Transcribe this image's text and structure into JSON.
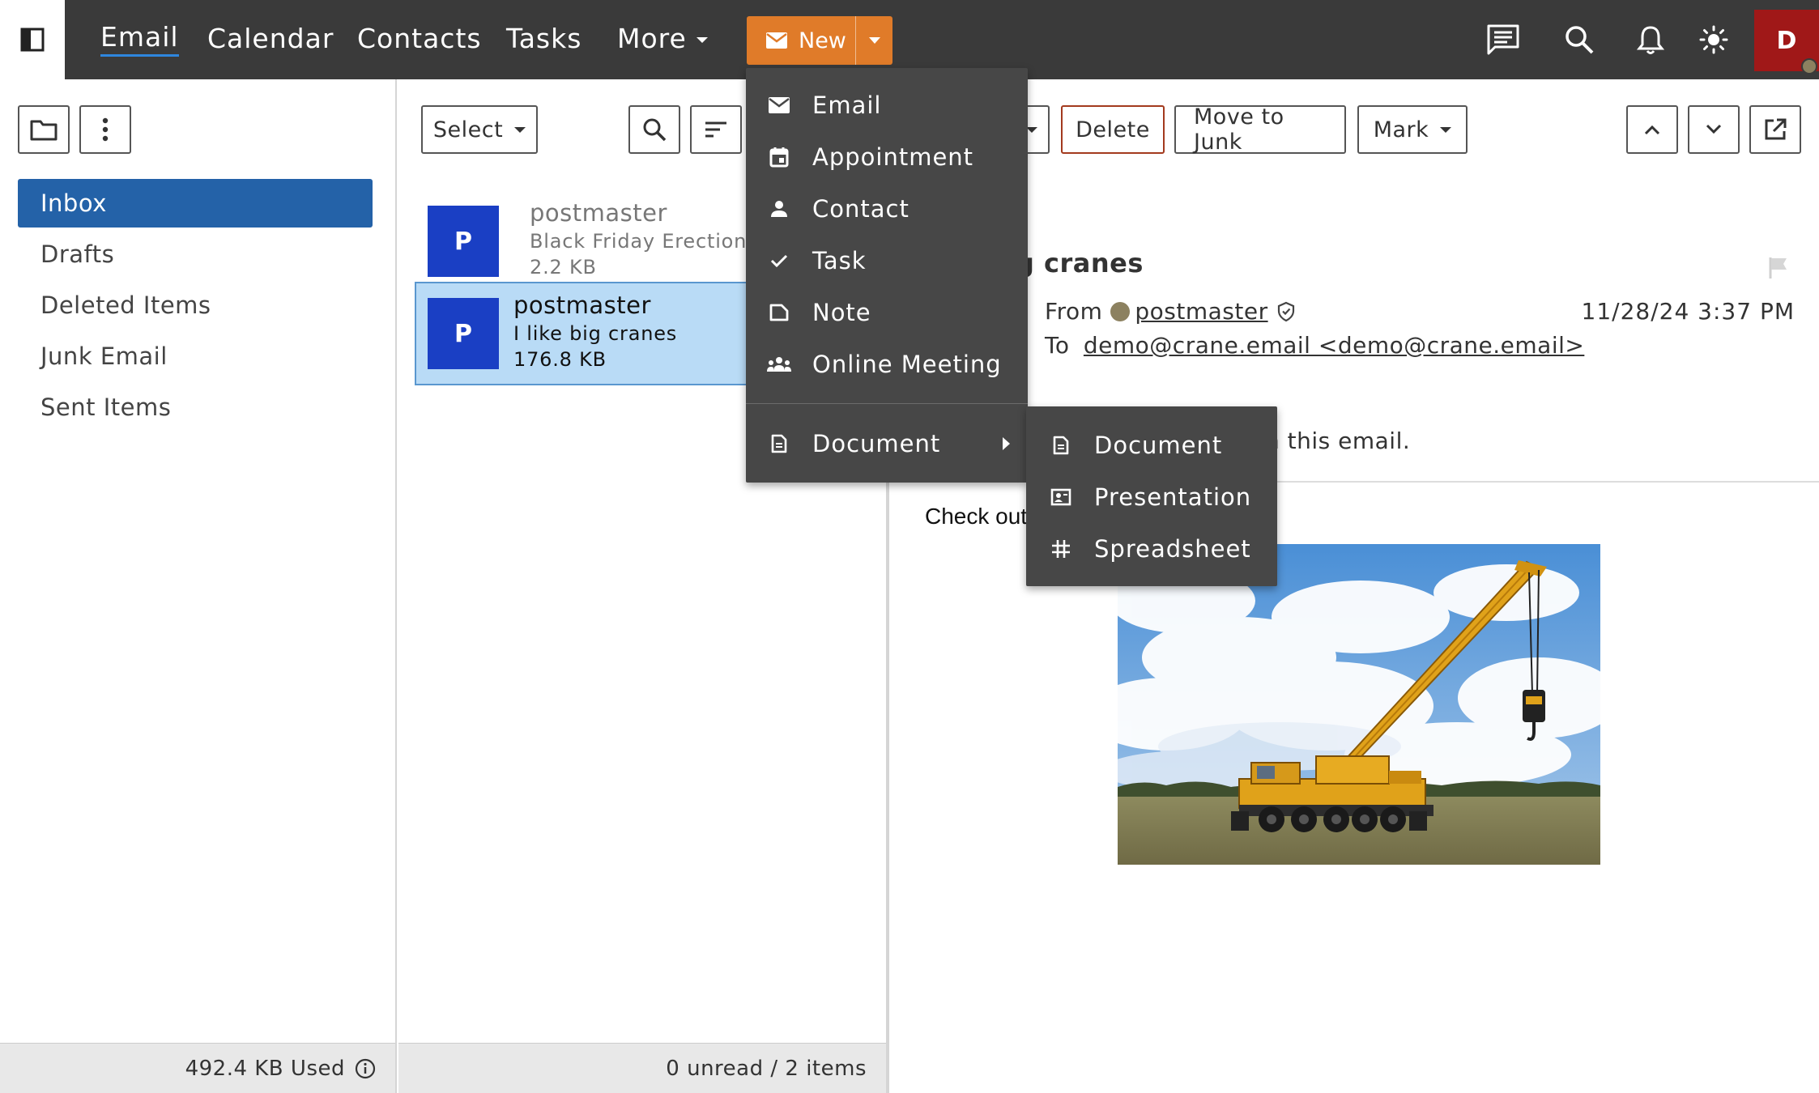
{
  "nav": {
    "items": [
      "Email",
      "Calendar",
      "Contacts",
      "Tasks",
      "More"
    ],
    "new_button": "New",
    "user_initial": "D"
  },
  "folders": {
    "items": [
      "Inbox",
      "Drafts",
      "Deleted Items",
      "Junk Email",
      "Sent Items"
    ],
    "storage_used": "492.4 KB Used"
  },
  "message_list": {
    "select_label": "Select",
    "messages": [
      {
        "initial": "P",
        "from": "postmaster",
        "subject": "Black Friday Erection",
        "size": "2.2 KB"
      },
      {
        "initial": "P",
        "from": "postmaster",
        "subject": "I like big cranes",
        "size": "176.8 KB"
      }
    ],
    "footer": "0 unread / 2 items"
  },
  "reading_pane": {
    "delete_label": "Delete",
    "junk_label": "Move to Junk",
    "mark_label": "Mark",
    "subject_visible": "g cranes",
    "from_label": "From",
    "sender": "postmaster",
    "date": "11/28/24 3:37 PM",
    "to_label": "To",
    "recipient": "demo@crane.email <demo@crane.email>",
    "notice_fragment": "h this email.",
    "body_fragment": "Check out"
  },
  "new_menu": {
    "items": [
      "Email",
      "Appointment",
      "Contact",
      "Task",
      "Note",
      "Online Meeting"
    ],
    "document": "Document"
  },
  "document_submenu": {
    "items": [
      "Document",
      "Presentation",
      "Spreadsheet"
    ]
  },
  "colors": {
    "topbar": "#3a3a3a",
    "accent_orange": "#e07b29",
    "inbox_selected": "#2462a8",
    "avatar_blue": "#1a3fc4",
    "user_avatar": "#a01818",
    "menu_bg": "#474747",
    "selected_row": "#b9dbf6"
  }
}
